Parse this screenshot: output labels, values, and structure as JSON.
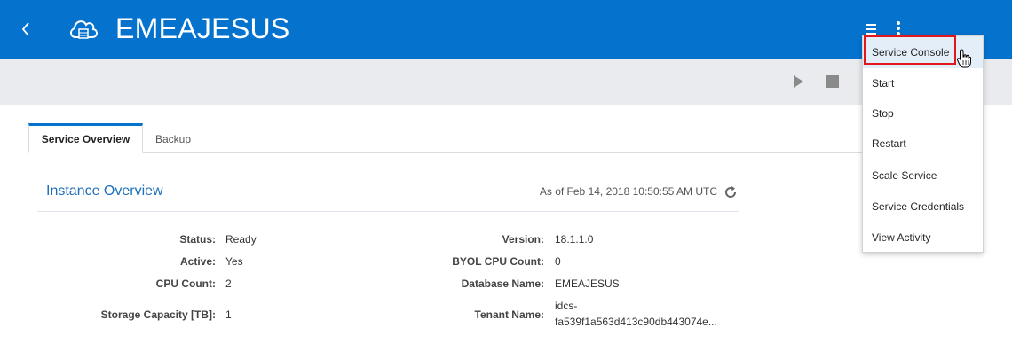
{
  "header": {
    "title": "EMEAJESUS",
    "back_icon": "chevron-left-icon",
    "logo_icon": "cloud-database-icon",
    "menu_icon": "hamburger-icon",
    "more_icon": "kebab-icon"
  },
  "actions": {
    "start_icon": "play-icon",
    "stop_icon": "stop-icon"
  },
  "tabs": [
    {
      "label": "Service Overview",
      "active": true
    },
    {
      "label": "Backup",
      "active": false
    }
  ],
  "overview": {
    "title": "Instance Overview",
    "as_of": "As of Feb 14, 2018 10:50:55 AM UTC",
    "refresh_icon": "refresh-icon",
    "left": [
      {
        "label": "Status:",
        "value": "Ready"
      },
      {
        "label": "Active:",
        "value": "Yes"
      },
      {
        "label": "CPU Count:",
        "value": "2"
      },
      {
        "label": "Storage Capacity [TB]:",
        "value": "1"
      }
    ],
    "right": [
      {
        "label": "Version:",
        "value": "18.1.1.0"
      },
      {
        "label": "BYOL CPU Count:",
        "value": "0"
      },
      {
        "label": "Database Name:",
        "value": "EMEAJESUS"
      },
      {
        "label": "Tenant Name:",
        "value_line1": "idcs-",
        "value_line2": "fa539f1a563d413c90db443074e..."
      }
    ]
  },
  "dropdown": {
    "items": [
      {
        "label": "Service Console"
      },
      {
        "label": "Start"
      },
      {
        "label": "Stop"
      },
      {
        "label": "Restart"
      },
      {
        "label": "Scale Service"
      },
      {
        "label": "Service Credentials"
      },
      {
        "label": "View Activity"
      }
    ]
  },
  "colors": {
    "brand": "#0572ce",
    "highlight_outline": "#e0171d",
    "action_bar": "#e9ebee"
  }
}
